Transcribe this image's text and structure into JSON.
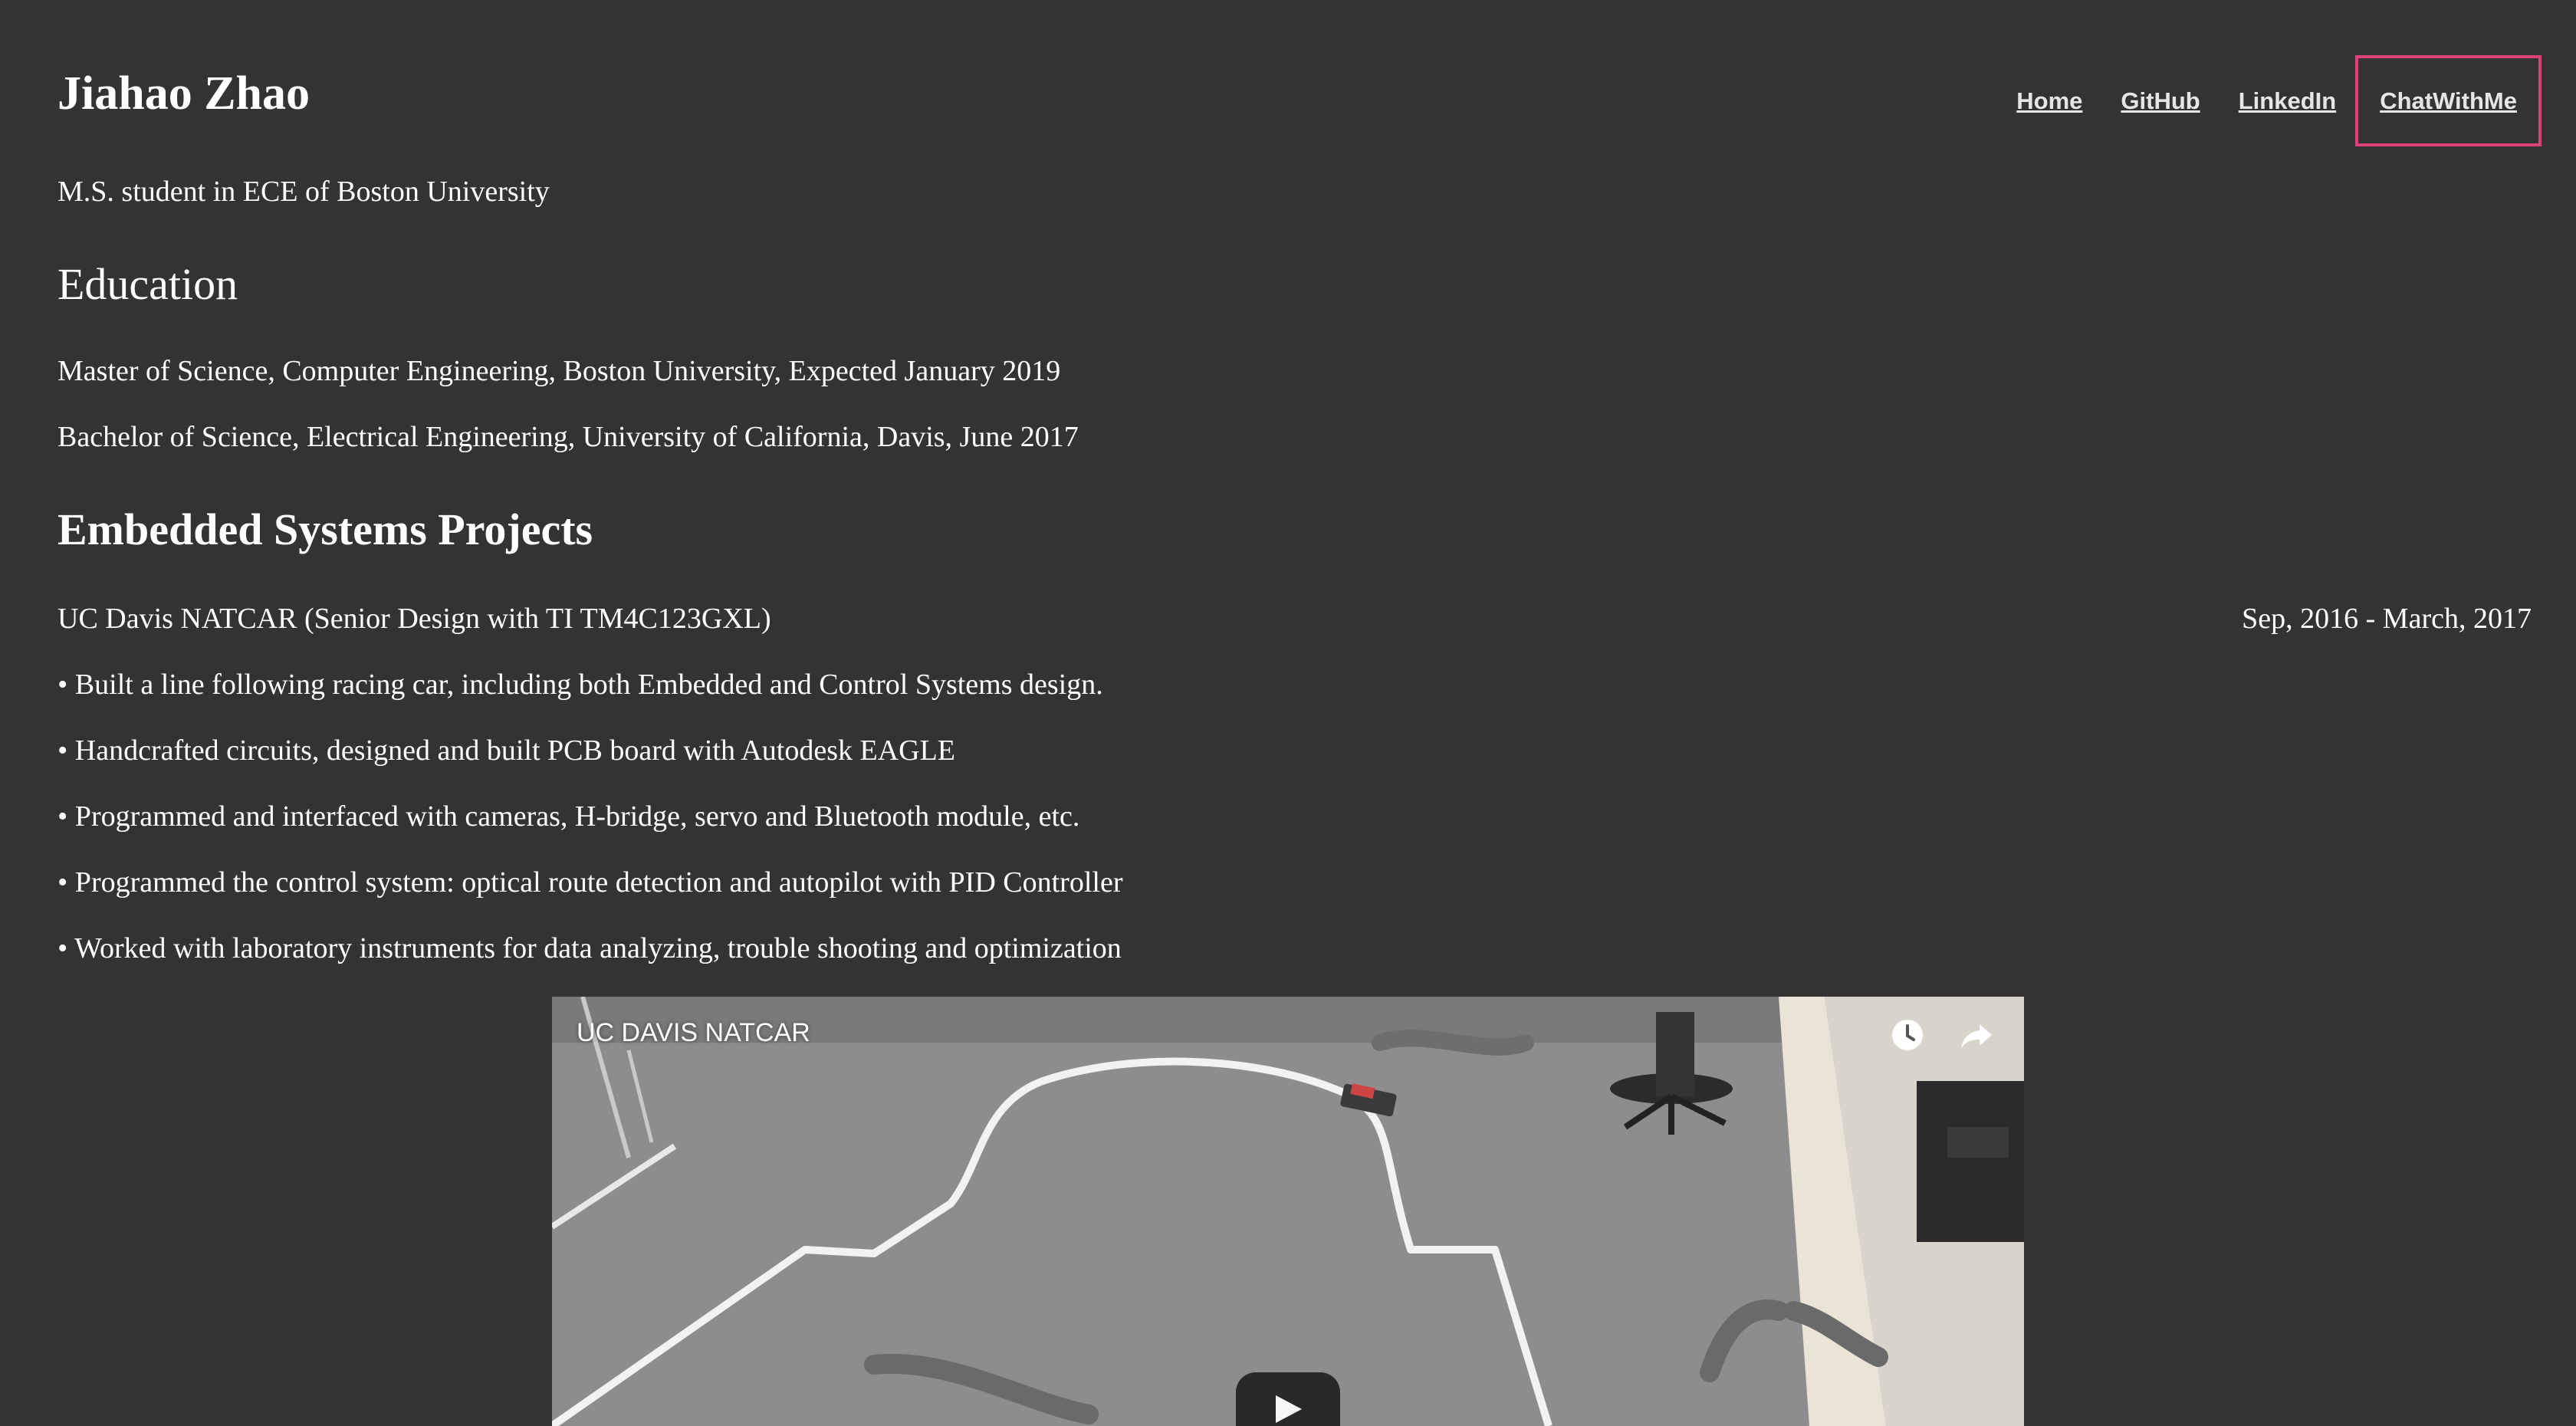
{
  "site": {
    "title": "Jiahao Zhao",
    "subtitle": "M.S. student in ECE of Boston University"
  },
  "nav": {
    "items": [
      {
        "label": "Home"
      },
      {
        "label": "GitHub"
      },
      {
        "label": "LinkedIn"
      },
      {
        "label": "ChatWithMe"
      }
    ],
    "highlight_color": "#e0407a"
  },
  "education": {
    "heading": "Education",
    "entries": [
      "Master of Science, Computer Engineering, Boston University, Expected January 2019",
      "Bachelor of Science, Electrical Engineering, University of California, Davis, June 2017"
    ]
  },
  "projects": {
    "heading": "Embedded Systems Projects",
    "items": [
      {
        "title": "UC Davis NATCAR (Senior Design with TI TM4C123GXL)",
        "date": "Sep, 2016 - March, 2017",
        "bullets": [
          "• Built a line following racing car, including both Embedded and Control Systems design.",
          "• Handcrafted circuits, designed and built PCB board with Autodesk EAGLE",
          "• Programmed and interfaced with cameras, H-bridge, servo and Bluetooth module, etc.",
          "• Programmed the control system: optical route detection and autopilot with PID Controller",
          "• Worked with laboratory instruments for data analyzing, trouble shooting and optimization"
        ],
        "video": {
          "title": "UC DAVIS NATCAR",
          "icons": [
            "watch-later-icon",
            "share-icon",
            "play-icon"
          ]
        }
      }
    ]
  },
  "colors": {
    "background": "#333333",
    "text": "#ffffff",
    "nav_text": "#e6e6e6"
  }
}
